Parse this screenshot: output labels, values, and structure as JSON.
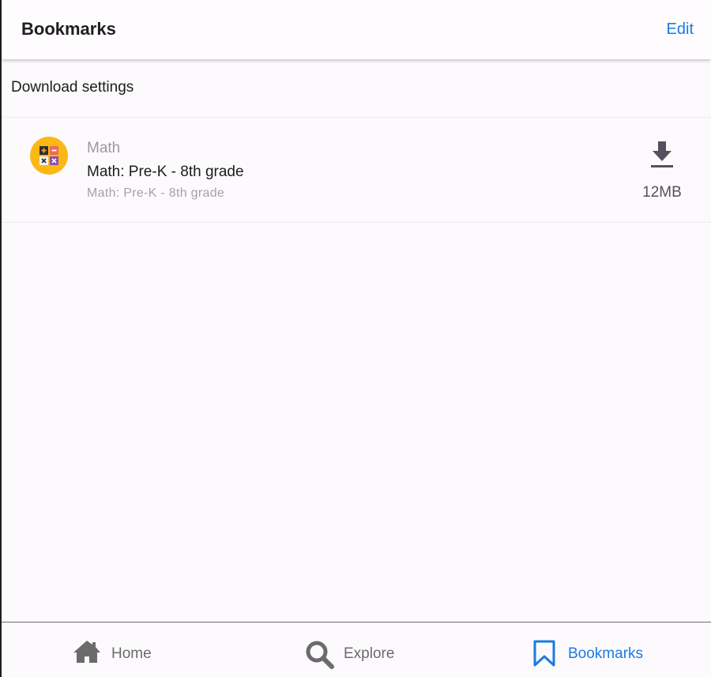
{
  "header": {
    "title": "Bookmarks",
    "edit_label": "Edit"
  },
  "download_settings": {
    "label": "Download settings"
  },
  "items": [
    {
      "category": "Math",
      "title": "Math: Pre-K - 8th grade",
      "subtitle": "Math: Pre-K - 8th grade",
      "size": "12MB",
      "icon": "math-operations-icon",
      "action_icon": "download-icon"
    }
  ],
  "tabs": [
    {
      "label": "Home",
      "icon": "home-icon",
      "active": false
    },
    {
      "label": "Explore",
      "icon": "search-icon",
      "active": false
    },
    {
      "label": "Bookmarks",
      "icon": "bookmark-icon",
      "active": true
    }
  ],
  "colors": {
    "accent": "#1a7be0",
    "math_icon_bg": "#fbb714",
    "inactive_tab": "#6b6b6b",
    "download_icon": "#55505e"
  }
}
